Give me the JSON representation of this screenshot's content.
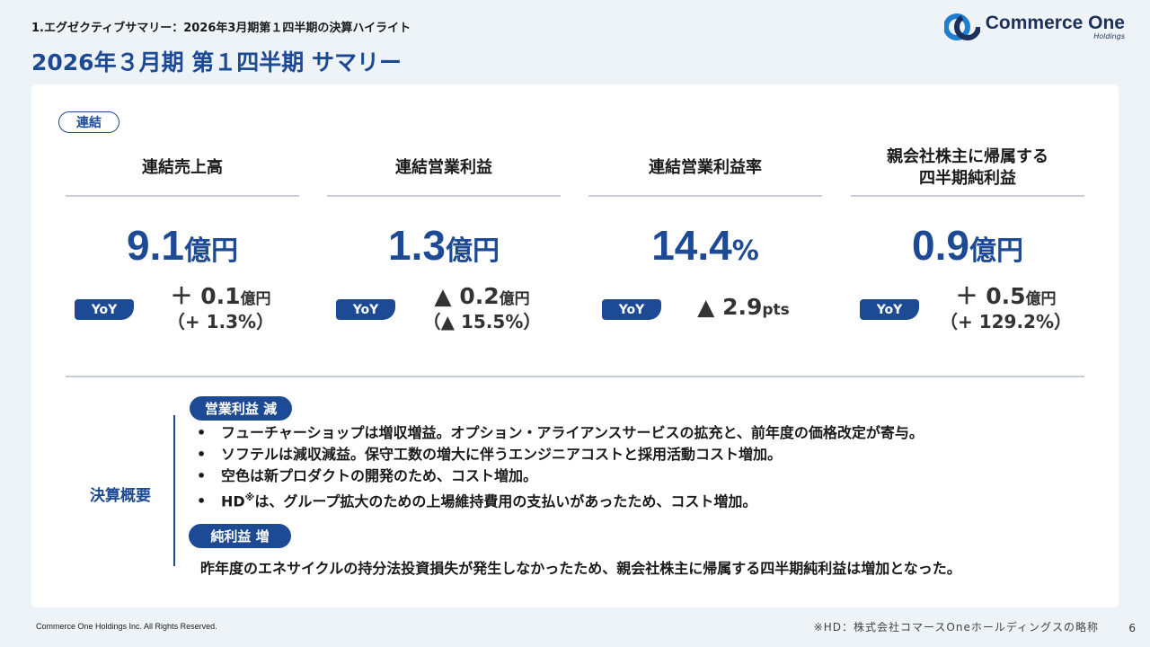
{
  "header": {
    "breadcrumb": "1.エグゼクティブサマリー：2026年3月期第１四半期の決算ハイライト",
    "title": "2026年３月期 第１四半期 サマリー",
    "logo_name": "Commerce One",
    "logo_sub": "Holdings"
  },
  "tag": "連結",
  "yoy_label": "YoY",
  "metrics": [
    {
      "label": "連結売上高",
      "value": "9.1",
      "unit": "億円",
      "delta": "＋ 0.1",
      "delta_unit": "億円",
      "delta_pct": "（+ 1.3%）"
    },
    {
      "label": "連結営業利益",
      "value": "1.3",
      "unit": "億円",
      "delta": "▲ 0.2",
      "delta_unit": "億円",
      "delta_pct": "（▲ 15.5%）"
    },
    {
      "label": "連結営業利益率",
      "value": "14.4",
      "unit": "%",
      "delta": "▲ 2.9",
      "delta_unit": "pts",
      "delta_pct": ""
    },
    {
      "label": "親会社株主に帰属する\n四半期純利益",
      "value": "0.9",
      "unit": "億円",
      "delta": "＋ 0.5",
      "delta_unit": "億円",
      "delta_pct": "（+ 129.2%）"
    }
  ],
  "summary": {
    "label": "決算概要",
    "op_pill": "営業利益 減",
    "bullet_mark": "•",
    "bullets": [
      "フューチャーショップは増収増益。オプション・アライアンスサービスの拡充と、前年度の価格改定が寄与。",
      "ソフテルは減収減益。保守工数の増大に伴うエンジニアコストと採用活動コスト増加。",
      "空色は新プロダクトの開発のため、コスト増加。"
    ],
    "bullet4_pre": "HD",
    "bullet4_sup": "※",
    "bullet4_post": "は、グループ拡大のための上場維持費用の支払いがあったため、コスト増加。",
    "net_pill": "純利益 増",
    "net_text": "昨年度のエネサイクルの持分法投資損失が発生しなかったため、親会社株主に帰属する四半期純利益は増加となった。"
  },
  "footer": {
    "copyright": "Commerce One Holdings Inc. All Rights Reserved.",
    "note": "※HD：株式会社コマースOneホールディングスの略称",
    "page": "6"
  },
  "colors": {
    "accent": "#1d4a94",
    "background": "#eef3f8"
  }
}
